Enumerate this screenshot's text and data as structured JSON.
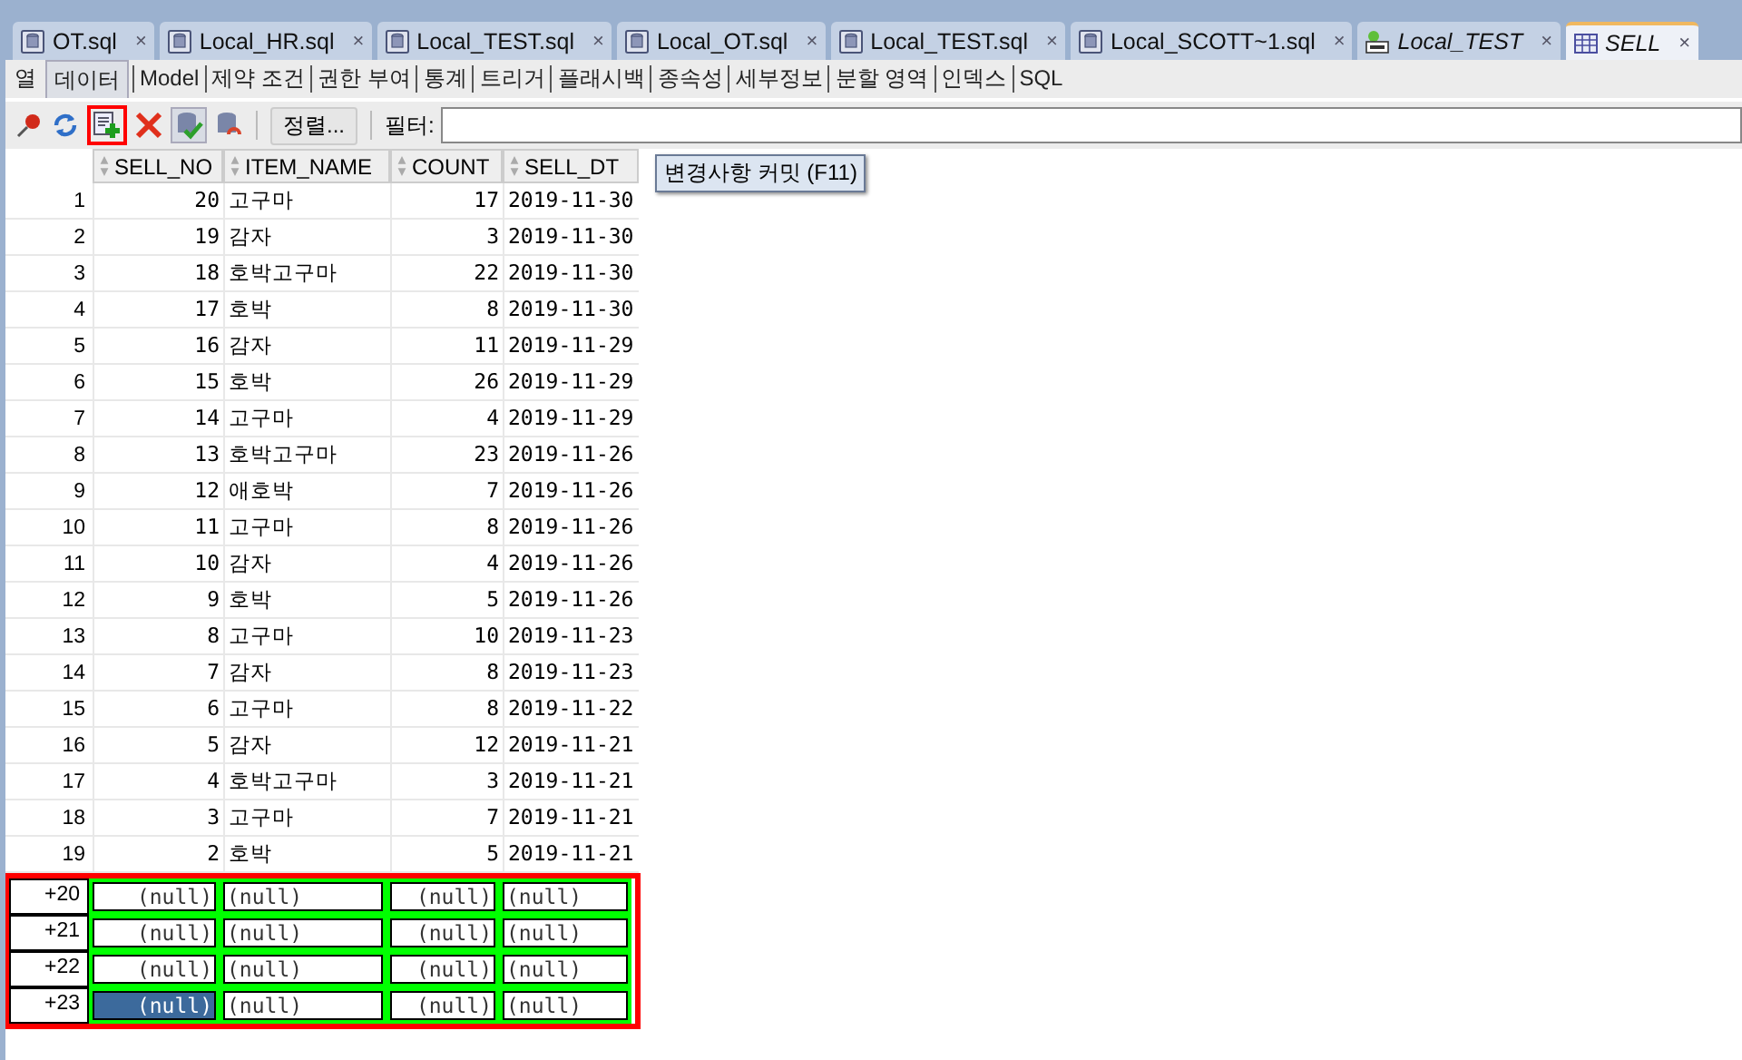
{
  "editor_tabs": [
    {
      "label": "OT.sql",
      "kind": "sql-file",
      "selected": false
    },
    {
      "label": "Local_HR.sql",
      "kind": "sql-file",
      "selected": false
    },
    {
      "label": "Local_TEST.sql",
      "kind": "sql-file",
      "selected": false
    },
    {
      "label": "Local_OT.sql",
      "kind": "sql-file",
      "selected": false
    },
    {
      "label": "Local_TEST.sql",
      "kind": "sql-file",
      "selected": false
    },
    {
      "label": "Local_SCOTT~1.sql",
      "kind": "sql-file",
      "selected": false
    },
    {
      "label": "Local_TEST",
      "kind": "connection",
      "selected": false
    },
    {
      "label": "SELL",
      "kind": "table",
      "selected": true
    }
  ],
  "close_glyph": "×",
  "sub_tabs": [
    {
      "label": "열",
      "selected": false
    },
    {
      "label": "데이터",
      "selected": true
    },
    {
      "label": "Model",
      "selected": false
    },
    {
      "label": "제약 조건",
      "selected": false
    },
    {
      "label": "권한 부여",
      "selected": false
    },
    {
      "label": "통계",
      "selected": false
    },
    {
      "label": "트리거",
      "selected": false
    },
    {
      "label": "플래시백",
      "selected": false
    },
    {
      "label": "종속성",
      "selected": false
    },
    {
      "label": "세부정보",
      "selected": false
    },
    {
      "label": "분할 영역",
      "selected": false
    },
    {
      "label": "인덱스",
      "selected": false
    },
    {
      "label": "SQL",
      "selected": false
    }
  ],
  "toolbar": {
    "sort_button": "정렬...",
    "filter_label": "필터:"
  },
  "tooltip": "변경사항 커밋 (F11)",
  "table": {
    "columns": [
      "SELL_NO",
      "ITEM_NAME",
      "COUNT",
      "SELL_DT"
    ],
    "rows": [
      {
        "num": "1",
        "inserted": false,
        "cells": [
          "20",
          "고구마",
          "17",
          "2019-11-30"
        ]
      },
      {
        "num": "2",
        "inserted": false,
        "cells": [
          "19",
          "감자",
          "3",
          "2019-11-30"
        ]
      },
      {
        "num": "3",
        "inserted": false,
        "cells": [
          "18",
          "호박고구마",
          "22",
          "2019-11-30"
        ]
      },
      {
        "num": "4",
        "inserted": false,
        "cells": [
          "17",
          "호박",
          "8",
          "2019-11-30"
        ]
      },
      {
        "num": "5",
        "inserted": false,
        "cells": [
          "16",
          "감자",
          "11",
          "2019-11-29"
        ]
      },
      {
        "num": "6",
        "inserted": false,
        "cells": [
          "15",
          "호박",
          "26",
          "2019-11-29"
        ]
      },
      {
        "num": "7",
        "inserted": false,
        "cells": [
          "14",
          "고구마",
          "4",
          "2019-11-29"
        ]
      },
      {
        "num": "8",
        "inserted": false,
        "cells": [
          "13",
          "호박고구마",
          "23",
          "2019-11-26"
        ]
      },
      {
        "num": "9",
        "inserted": false,
        "cells": [
          "12",
          "애호박",
          "7",
          "2019-11-26"
        ]
      },
      {
        "num": "10",
        "inserted": false,
        "cells": [
          "11",
          "고구마",
          "8",
          "2019-11-26"
        ]
      },
      {
        "num": "11",
        "inserted": false,
        "cells": [
          "10",
          "감자",
          "4",
          "2019-11-26"
        ]
      },
      {
        "num": "12",
        "inserted": false,
        "cells": [
          "9",
          "호박",
          "5",
          "2019-11-26"
        ]
      },
      {
        "num": "13",
        "inserted": false,
        "cells": [
          "8",
          "고구마",
          "10",
          "2019-11-23"
        ]
      },
      {
        "num": "14",
        "inserted": false,
        "cells": [
          "7",
          "감자",
          "8",
          "2019-11-23"
        ]
      },
      {
        "num": "15",
        "inserted": false,
        "cells": [
          "6",
          "고구마",
          "8",
          "2019-11-22"
        ]
      },
      {
        "num": "16",
        "inserted": false,
        "cells": [
          "5",
          "감자",
          "12",
          "2019-11-21"
        ]
      },
      {
        "num": "17",
        "inserted": false,
        "cells": [
          "4",
          "호박고구마",
          "3",
          "2019-11-21"
        ]
      },
      {
        "num": "18",
        "inserted": false,
        "cells": [
          "3",
          "고구마",
          "7",
          "2019-11-21"
        ]
      },
      {
        "num": "19",
        "inserted": false,
        "cells": [
          "2",
          "호박",
          "5",
          "2019-11-21"
        ]
      },
      {
        "num": "+20",
        "inserted": true,
        "cells": [
          "(null)",
          "(null)",
          "(null)",
          "(null)"
        ],
        "selected": [
          false,
          false,
          false,
          false
        ]
      },
      {
        "num": "+21",
        "inserted": true,
        "cells": [
          "(null)",
          "(null)",
          "(null)",
          "(null)"
        ],
        "selected": [
          false,
          false,
          false,
          false
        ]
      },
      {
        "num": "+22",
        "inserted": true,
        "cells": [
          "(null)",
          "(null)",
          "(null)",
          "(null)"
        ],
        "selected": [
          false,
          false,
          false,
          false
        ]
      },
      {
        "num": "+23",
        "inserted": true,
        "cells": [
          "(null)",
          "(null)",
          "(null)",
          "(null)"
        ],
        "selected": [
          true,
          false,
          false,
          false
        ]
      }
    ]
  }
}
